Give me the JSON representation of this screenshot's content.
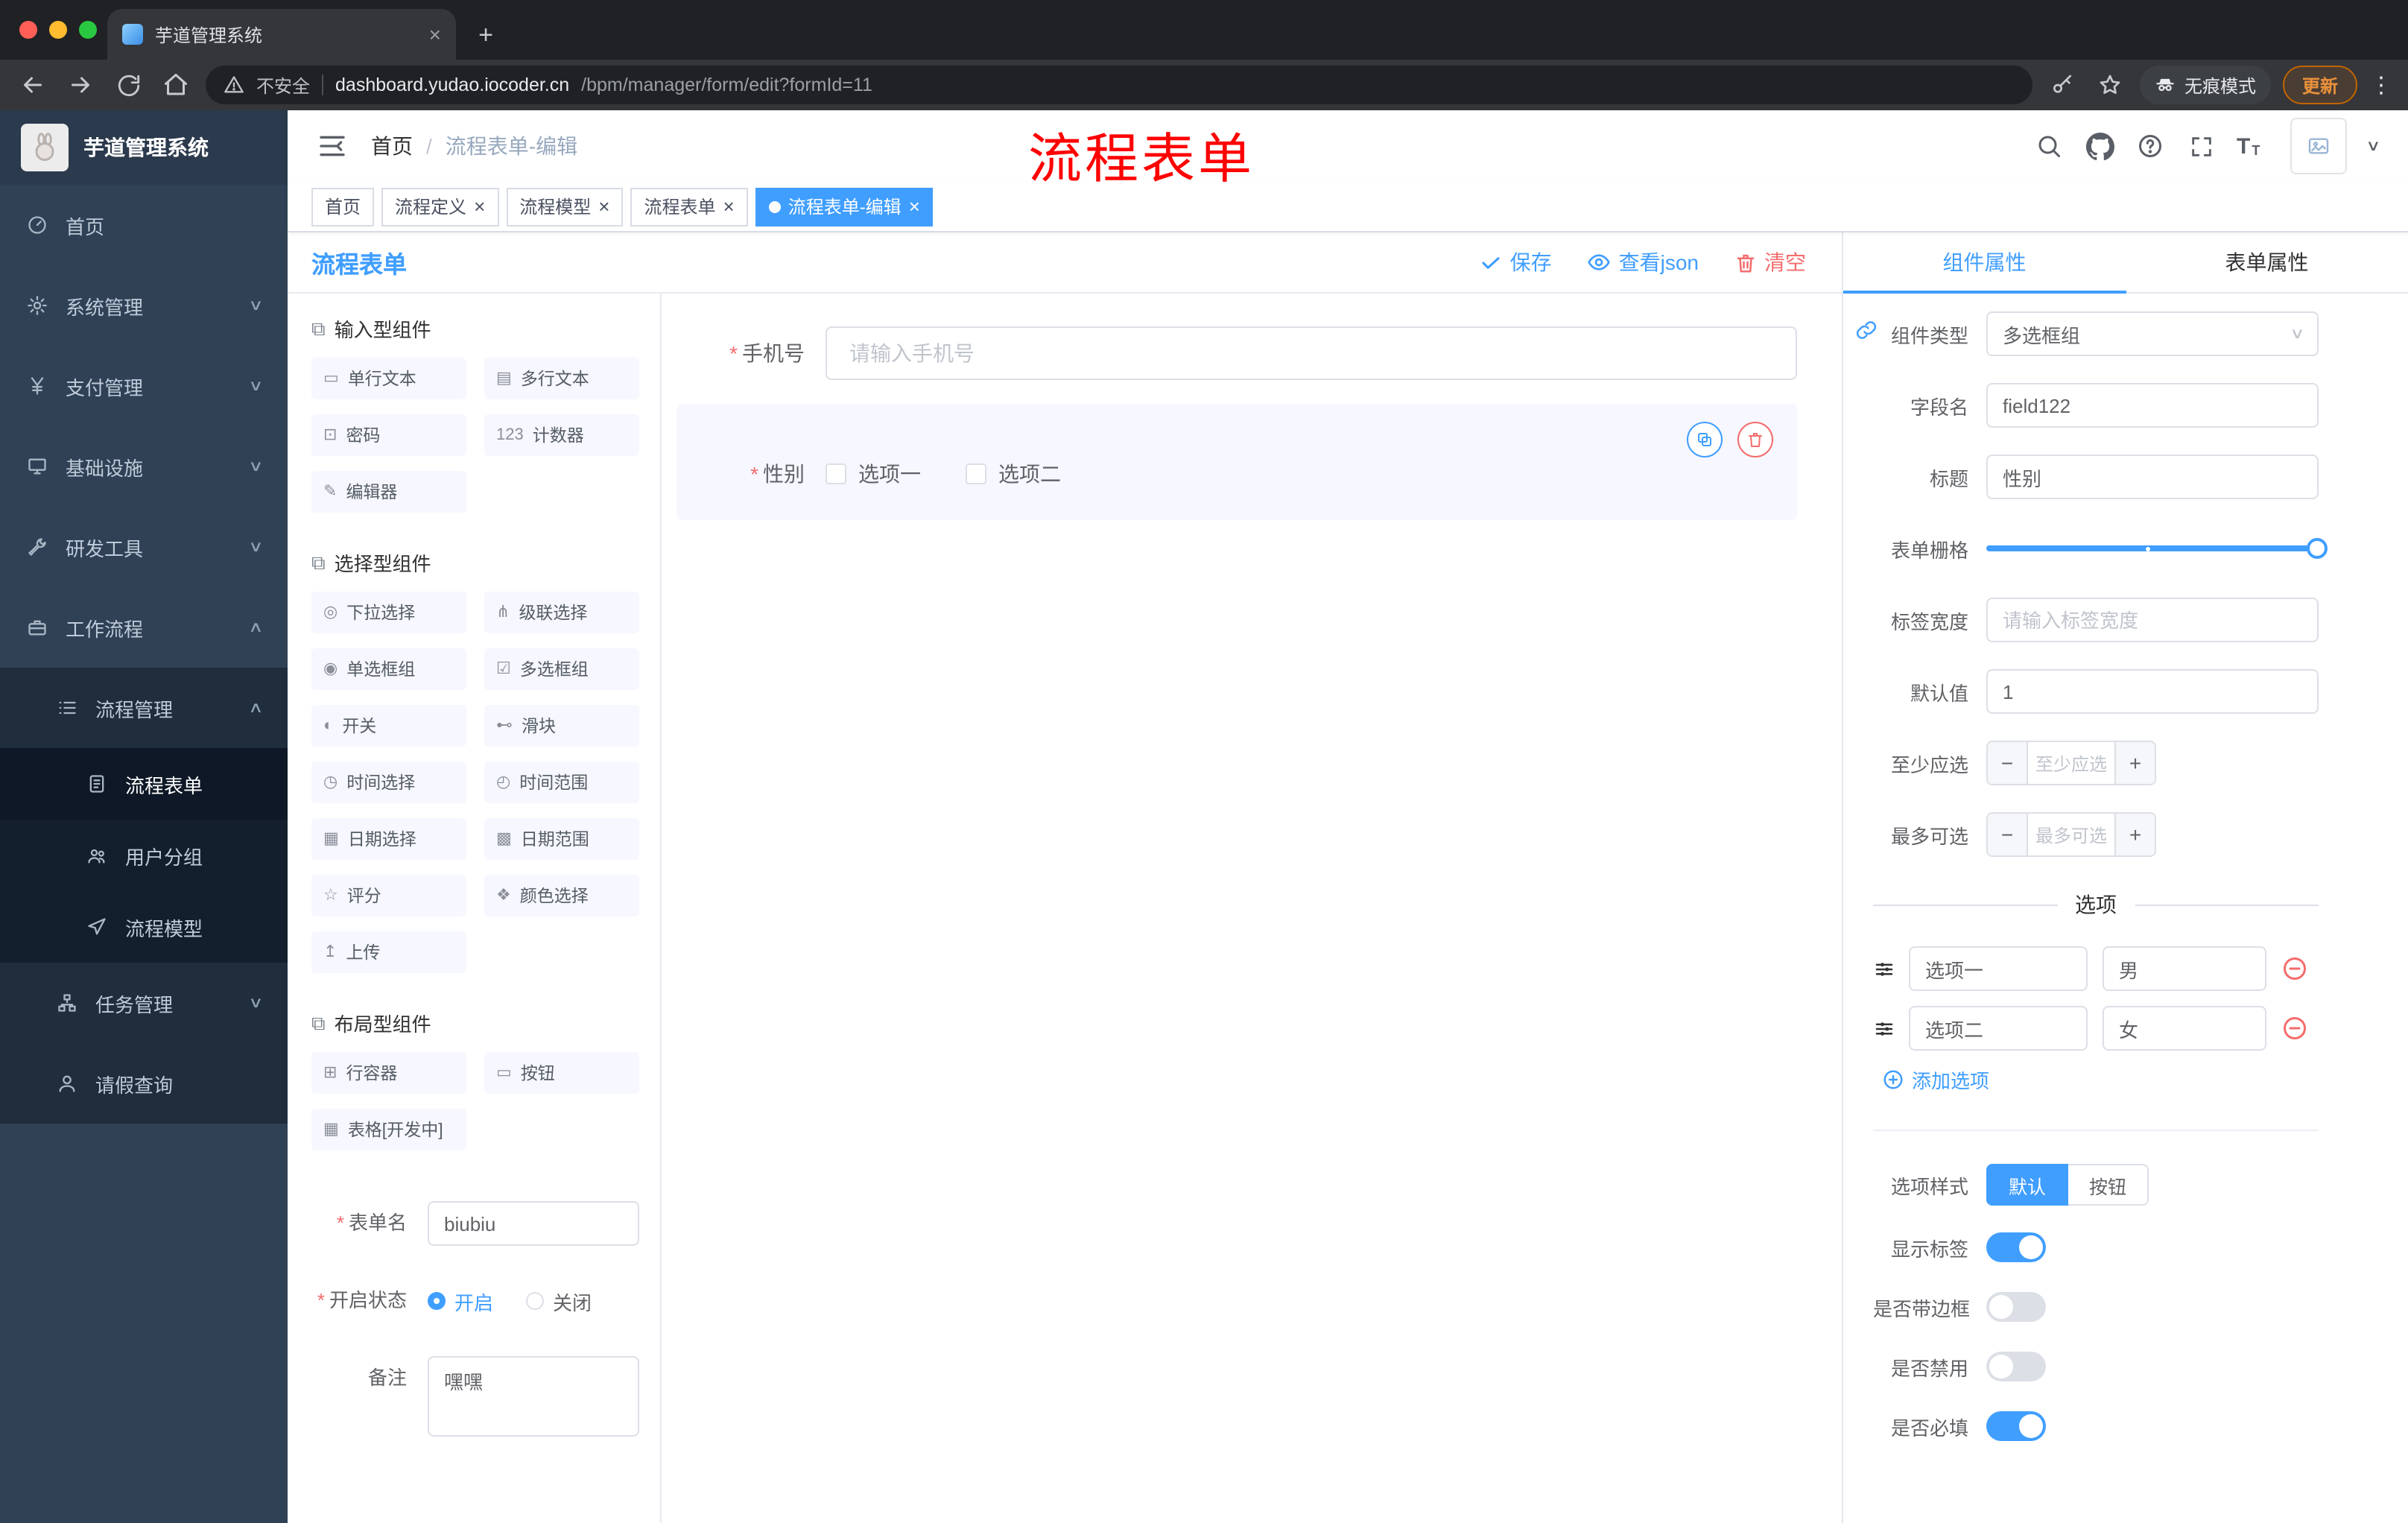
{
  "browser": {
    "tab_title": "芋道管理系统",
    "security_label": "不安全",
    "url_host": "dashboard.yudao.iocoder.cn",
    "url_path": "/bpm/manager/form/edit?formId=11",
    "incognito_label": "无痕模式",
    "update_label": "更新"
  },
  "glyphs": {
    "chevron_down": "∨",
    "chevron_up": "∧",
    "close": "×",
    "plus": "+",
    "minus": "−",
    "kebab": "⋮",
    "slash": "/",
    "dropdown_arrow": "∨",
    "text_icon": "T"
  },
  "sidebar": {
    "logo_title": "芋道管理系统",
    "items": [
      {
        "label": "首页"
      },
      {
        "label": "系统管理"
      },
      {
        "label": "支付管理"
      },
      {
        "label": "基础设施"
      },
      {
        "label": "研发工具"
      },
      {
        "label": "工作流程"
      },
      {
        "label": "流程管理"
      },
      {
        "label": "流程表单"
      },
      {
        "label": "用户分组"
      },
      {
        "label": "流程模型"
      },
      {
        "label": "任务管理"
      },
      {
        "label": "请假查询"
      }
    ]
  },
  "header": {
    "breadcrumb_home": "首页",
    "breadcrumb_current": "流程表单-编辑",
    "annotation": "流程表单"
  },
  "tags": [
    {
      "label": "首页"
    },
    {
      "label": "流程定义"
    },
    {
      "label": "流程模型"
    },
    {
      "label": "流程表单"
    },
    {
      "label": "流程表单-编辑"
    }
  ],
  "components_panel": {
    "title": "流程表单",
    "sections": [
      {
        "title": "输入型组件",
        "items": [
          {
            "icon": "▭",
            "label": "单行文本"
          },
          {
            "icon": "▤",
            "label": "多行文本"
          },
          {
            "icon": "⊡",
            "label": "密码"
          },
          {
            "icon": "123",
            "label": "计数器"
          },
          {
            "icon": "✎",
            "label": "编辑器"
          }
        ]
      },
      {
        "title": "选择型组件",
        "items": [
          {
            "icon": "◎",
            "label": "下拉选择"
          },
          {
            "icon": "⋔",
            "label": "级联选择"
          },
          {
            "icon": "◉",
            "label": "单选框组"
          },
          {
            "icon": "☑",
            "label": "多选框组"
          },
          {
            "icon": "◐",
            "label": "开关"
          },
          {
            "icon": "⊷",
            "label": "滑块"
          },
          {
            "icon": "◷",
            "label": "时间选择"
          },
          {
            "icon": "◴",
            "label": "时间范围"
          },
          {
            "icon": "▦",
            "label": "日期选择"
          },
          {
            "icon": "▩",
            "label": "日期范围"
          },
          {
            "icon": "☆",
            "label": "评分"
          },
          {
            "icon": "❖",
            "label": "颜色选择"
          },
          {
            "icon": "↥",
            "label": "上传"
          }
        ]
      },
      {
        "title": "布局型组件",
        "items": [
          {
            "icon": "⊞",
            "label": "行容器"
          },
          {
            "icon": "▭",
            "label": "按钮"
          },
          {
            "icon": "▦",
            "label": "表格[开发中]"
          }
        ]
      }
    ],
    "form": {
      "name_label": "表单名",
      "name_value": "biubiu",
      "status_label": "开启状态",
      "status_on": "开启",
      "status_off": "关闭",
      "remark_label": "备注",
      "remark_value": "嘿嘿"
    }
  },
  "canvas": {
    "save_label": "保存",
    "view_json_label": "查看json",
    "clear_label": "清空",
    "phone": {
      "label": "手机号",
      "placeholder": "请输入手机号"
    },
    "gender": {
      "label": "性别",
      "option1": "选项一",
      "option2": "选项二"
    }
  },
  "props": {
    "tab_component": "组件属性",
    "tab_form": "表单属性",
    "component_type_label": "组件类型",
    "component_type_value": "多选框组",
    "field_name_label": "字段名",
    "field_name_value": "field122",
    "title_label": "标题",
    "title_value": "性别",
    "grid_label": "表单栅格",
    "label_width_label": "标签宽度",
    "label_width_placeholder": "请输入标签宽度",
    "default_label": "默认值",
    "default_value": "1",
    "min_label": "至少应选",
    "min_placeholder": "至少应选",
    "max_label": "最多可选",
    "max_placeholder": "最多可选",
    "options_title": "选项",
    "options": [
      {
        "label": "选项一",
        "value": "男"
      },
      {
        "label": "选项二",
        "value": "女"
      }
    ],
    "add_option_label": "添加选项",
    "style_label": "选项样式",
    "style_default": "默认",
    "style_button": "按钮",
    "show_label_label": "显示标签",
    "border_label": "是否带边框",
    "disabled_label": "是否禁用",
    "required_label": "是否必填"
  },
  "colors": {
    "primary": "#409eff",
    "danger": "#f56c6c",
    "annotation": "#ff0000"
  }
}
